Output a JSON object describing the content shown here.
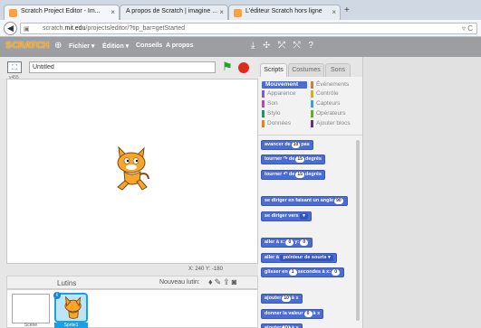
{
  "browser": {
    "tabs": [
      {
        "label": "Scratch Project Editor - Im..."
      },
      {
        "label": "A propos de Scratch | imagine ..."
      },
      {
        "label": "L'éditeur Scratch hors ligne"
      }
    ],
    "url_prefix": "scratch.",
    "url_host": "mit.edu",
    "url_path": "/projects/editor/?tip_bar=getStarted"
  },
  "menubar": {
    "logo": "SCRATCH",
    "items": [
      {
        "label": "Fichier ▾"
      },
      {
        "label": "Édition ▾"
      },
      {
        "label": "Conseils"
      },
      {
        "label": "A propos"
      }
    ],
    "tool_icons": "⤓ ✣ ⤱ ⤲ ?"
  },
  "stage": {
    "version": "v455",
    "title_value": "Untitled",
    "coords": "X: 240  Y: -180"
  },
  "sprites": {
    "title": "Lutins",
    "new_sprite": "Nouveau lutin:",
    "scene_label": "Scène",
    "sprite_label": "Sprite1"
  },
  "palette": {
    "tabs": [
      {
        "label": "Scripts"
      },
      {
        "label": "Costumes"
      },
      {
        "label": "Sons"
      }
    ],
    "categories": [
      {
        "label": "Mouvement",
        "color": "#4a6cd4"
      },
      {
        "label": "Événements",
        "color": "#c88330"
      },
      {
        "label": "Apparence",
        "color": "#8a55d7"
      },
      {
        "label": "Contrôle",
        "color": "#e1a91a"
      },
      {
        "label": "Son",
        "color": "#bb42c3"
      },
      {
        "label": "Capteurs",
        "color": "#2ca5e2"
      },
      {
        "label": "Stylo",
        "color": "#0e9a6c"
      },
      {
        "label": "Opérateurs",
        "color": "#5cb712"
      },
      {
        "label": "Données",
        "color": "#ee7d16"
      },
      {
        "label": "Ajouter blocs",
        "color": "#632d99"
      }
    ],
    "blocks": {
      "b1_a": "avancer de",
      "b1_n": "10",
      "b1_b": "pas",
      "b2_a": "tourner ↷ de",
      "b2_n": "15",
      "b2_b": "degrés",
      "b3_a": "tourner ↶ de",
      "b3_n": "15",
      "b3_b": "degrés",
      "b4_a": "se diriger en faisant un angle",
      "b4_n": "90",
      "b5_a": "se diriger vers",
      "b5_d": "▾",
      "b6_a": "aller à x:",
      "b6_n1": "0",
      "b6_b": "y:",
      "b6_n2": "0",
      "b7_a": "aller à",
      "b7_d": "pointeur de souris ▾",
      "b8_a": "glisser en",
      "b8_n": "1",
      "b8_b": "secondes à x:",
      "b8_n2": "0",
      "b9_a": "ajouter",
      "b9_n": "10",
      "b9_b": "à x",
      "b10_a": "donner la valeur",
      "b10_n": "0",
      "b10_b": "à x",
      "b11_a": "ajouter",
      "b11_n": "10",
      "b11_b": "à y"
    }
  },
  "colors": {
    "accent": "#4a6cd4",
    "menubar": "#9c9ea2",
    "flag": "#27a32c",
    "stop": "#e12a1e",
    "sprite_selected": "#19a0e5"
  }
}
